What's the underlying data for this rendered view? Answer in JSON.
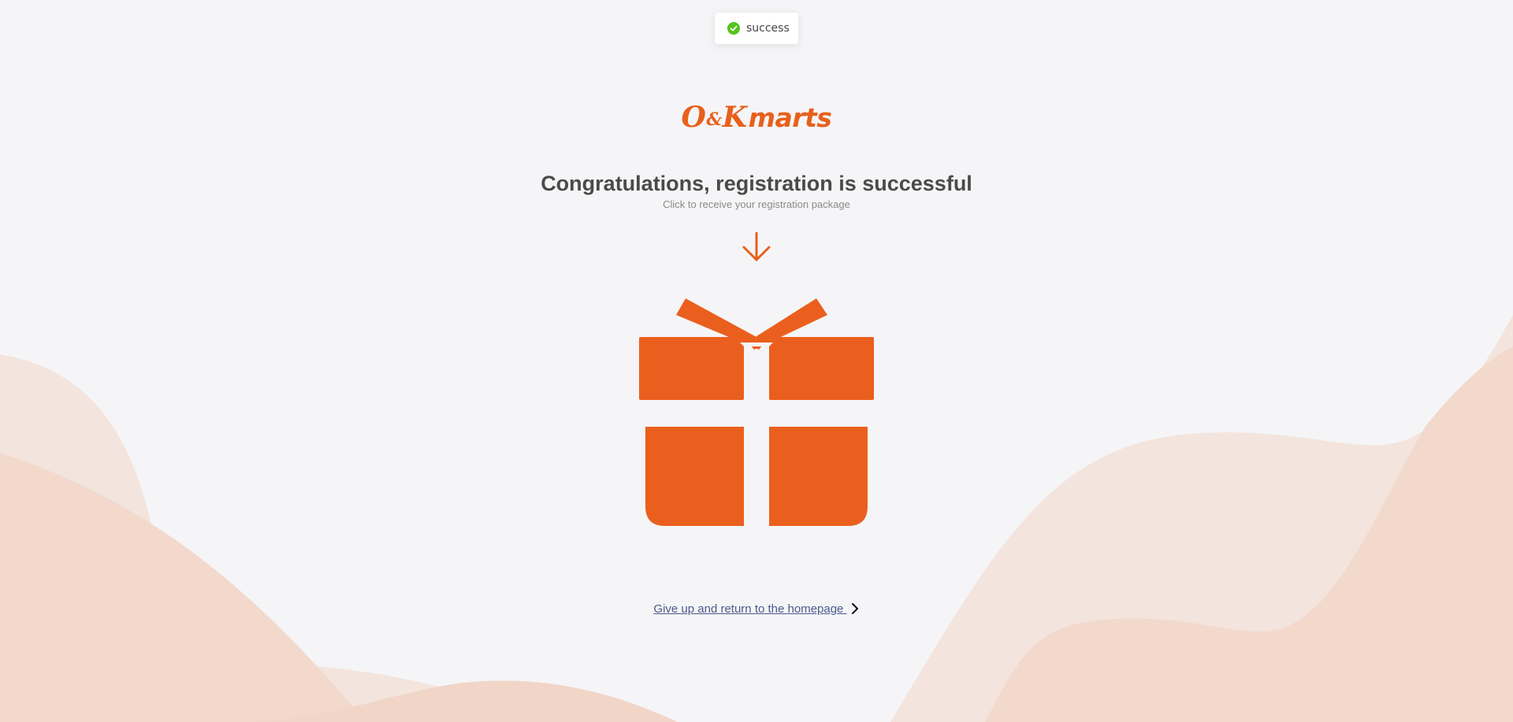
{
  "toast": {
    "message": "success",
    "icon": "check-circle-icon",
    "icon_color": "#52c41a"
  },
  "brand": {
    "logo_part1": "O",
    "logo_amp": "&",
    "logo_part2": "K",
    "logo_part3": "marts",
    "color": "#e8601c"
  },
  "main": {
    "title": "Congratulations, registration is successful",
    "subtitle": "Click to receive your registration package",
    "arrow_icon": "arrow-down-icon",
    "gift_icon": "gift-icon",
    "gift_color": "#eb5f1e"
  },
  "footer": {
    "home_link_label": "Give up and return to the homepage ",
    "chevron_icon": "chevron-right-icon"
  },
  "colors": {
    "background": "#f5f5f7",
    "wave_light": "#f3e4dd",
    "wave_mid": "#f2d9cc"
  }
}
